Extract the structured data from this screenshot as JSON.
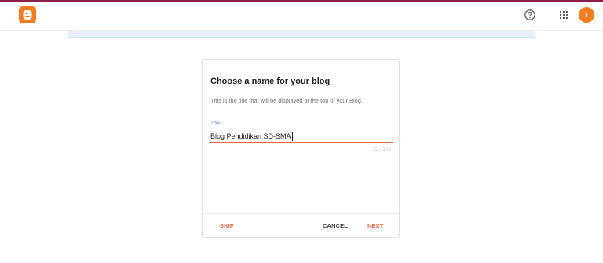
{
  "header": {
    "logo_icon": "blogger-logo-icon",
    "help_icon": "help-circle-icon",
    "apps_icon": "apps-grid-icon",
    "avatar_initial": "r",
    "accent_color": "#f57c1f"
  },
  "dialog": {
    "title": "Choose a name for your blog",
    "subtitle": "This is the title that will be displayed at the top of your Blog.",
    "field": {
      "label": "Title",
      "value": "Blog Pendidikan SD-SMA",
      "counter": "22 / 100"
    },
    "buttons": {
      "skip": "SKIP",
      "cancel": "CANCEL",
      "next": "NEXT"
    }
  }
}
